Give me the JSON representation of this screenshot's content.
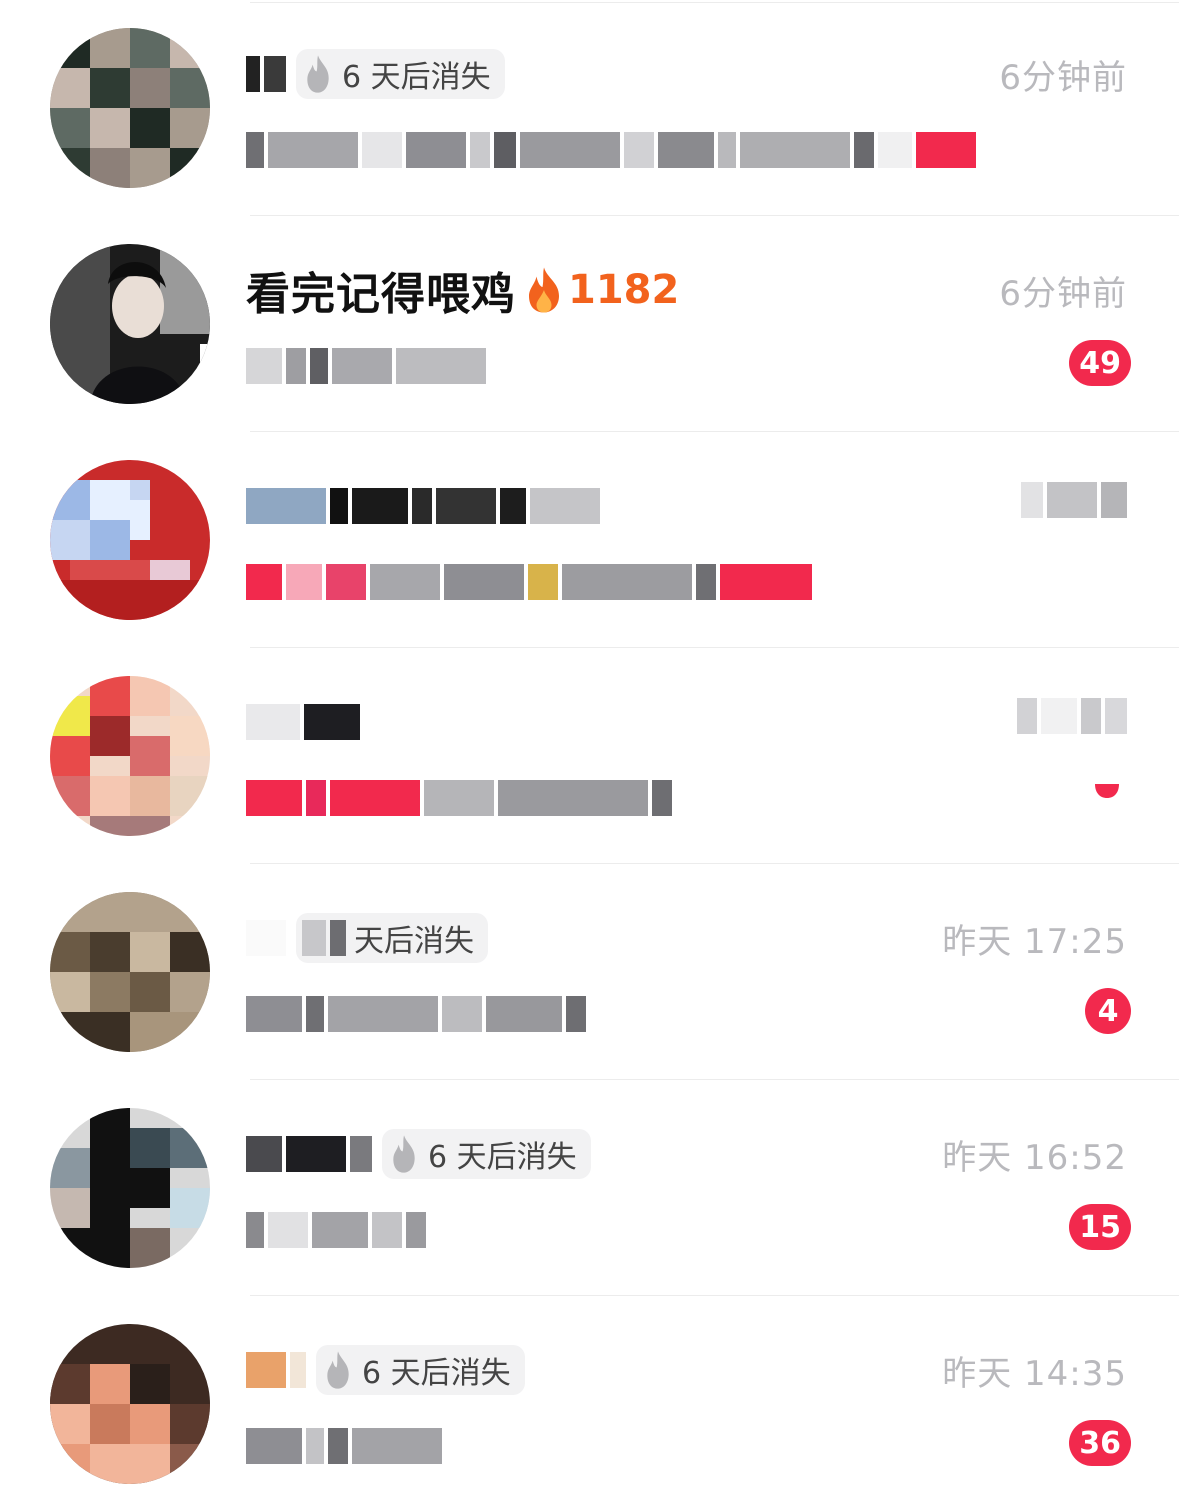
{
  "conversations": [
    {
      "name": "",
      "vanish_label": "6 天后消失",
      "time": "6分钟前",
      "unread": "",
      "avatar_colors": [
        "#1f2a24",
        "#a79b8e",
        "#5e6a63",
        "#c6b7ad",
        "#2e3b33",
        "#8d8079"
      ]
    },
    {
      "name": "看完记得喂鸡",
      "fire_count": "1182",
      "time": "6分钟前",
      "unread": "49",
      "avatar_colors": [
        "#1a1a1a",
        "#d9d9d9",
        "#3b3b3b",
        "#7a7a7a",
        "#f0f0f0",
        "#555555"
      ]
    },
    {
      "name": "",
      "time": "",
      "unread": "",
      "avatar_colors": [
        "#c92b2b",
        "#9cb8e6",
        "#e6f0ff",
        "#b31f1f",
        "#c6d6f2",
        "#d94a4a"
      ]
    },
    {
      "name": "",
      "time": "",
      "unread": "",
      "avatar_colors": [
        "#e84a4a",
        "#f5c7b2",
        "#f0e84a",
        "#9c2a2a",
        "#f7d8c2",
        "#d96b6b"
      ]
    },
    {
      "name": "",
      "vanish_label": "天后消失",
      "time": "昨天 17:25",
      "unread": "4",
      "avatar_colors": [
        "#6b5a45",
        "#b3a28c",
        "#4a3d2e",
        "#8c7a62",
        "#c9b8a0",
        "#3a2f24"
      ]
    },
    {
      "name": "",
      "vanish_label": "6 天后消失",
      "time": "昨天 16:52",
      "unread": "15",
      "avatar_colors": [
        "#111111",
        "#8a97a0",
        "#d8d8d8",
        "#3a4a52",
        "#c5b8b0",
        "#5c6e78"
      ]
    },
    {
      "name": "",
      "vanish_label": "6 天后消失",
      "time": "昨天 14:35",
      "unread": "36",
      "avatar_colors": [
        "#2a1f1a",
        "#e89a7a",
        "#5c3a2e",
        "#f2b59a",
        "#3d2a22",
        "#c97a5c"
      ]
    }
  ]
}
